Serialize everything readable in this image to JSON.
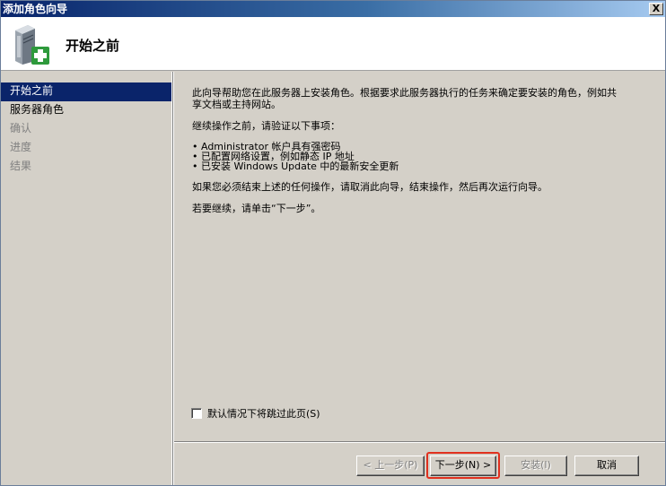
{
  "window": {
    "title": "添加角色向导",
    "close_label": "X"
  },
  "header": {
    "title": "开始之前",
    "icon": "server-add-icon"
  },
  "nav": {
    "items": [
      {
        "label": "开始之前",
        "state": "active"
      },
      {
        "label": "服务器角色",
        "state": "normal"
      },
      {
        "label": "确认",
        "state": "dim"
      },
      {
        "label": "进度",
        "state": "dim"
      },
      {
        "label": "结果",
        "state": "dim"
      }
    ]
  },
  "content": {
    "intro_line1": "此向导帮助您在此服务器上安装角色。根据要求此服务器执行的任务来确定要安装的角色，例如共",
    "intro_line2": "享文档或主持网站。",
    "verify_heading": "继续操作之前，请验证以下事项：",
    "bullets": [
      "• Administrator 帐户具有强密码",
      "• 已配置网络设置，例如静态 IP 地址",
      "• 已安装 Windows Update 中的最新安全更新"
    ],
    "cancel_hint": "如果您必须结束上述的任何操作，请取消此向导，结束操作，然后再次运行向导。",
    "continue_hint": "若要继续，请单击“下一步”。"
  },
  "skip_checkbox": {
    "label": "默认情况下将跳过此页(S)",
    "checked": false
  },
  "buttons": {
    "prev": "< 上一步(P)",
    "next": "下一步(N) >",
    "install": "安装(I)",
    "cancel": "取消"
  },
  "colors": {
    "highlight": "#e0301e",
    "nav_active": "#0a246a"
  }
}
